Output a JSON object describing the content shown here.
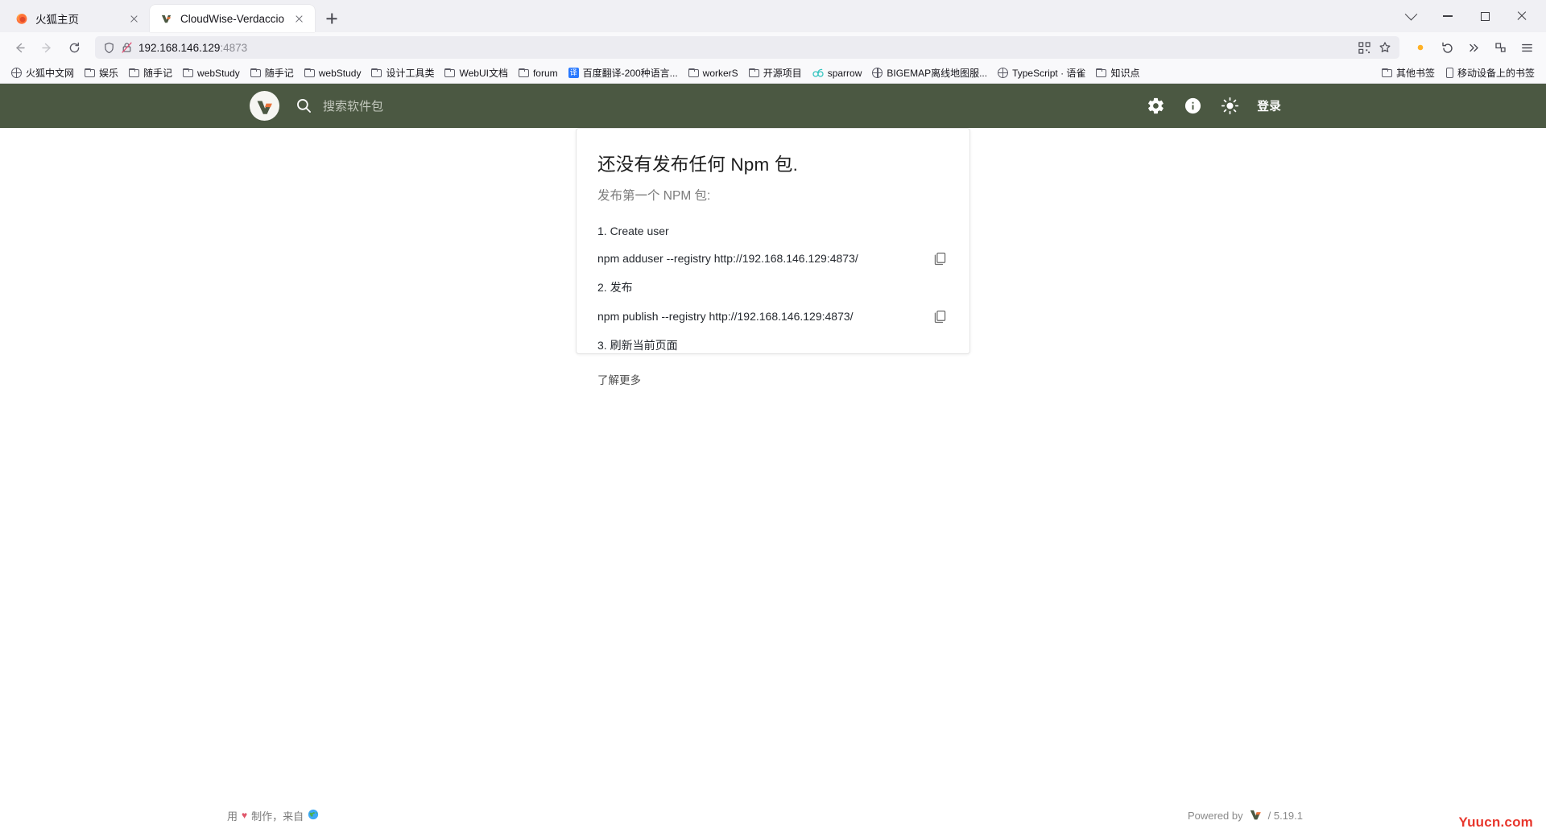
{
  "browser": {
    "tabs": [
      {
        "title": "火狐主页",
        "favicon": "firefox-icon",
        "active": false
      },
      {
        "title": "CloudWise-Verdaccio",
        "favicon": "verdaccio-icon",
        "active": true
      }
    ],
    "newtab_label": "+",
    "nav": {
      "back_icon": "back-arrow-icon",
      "forward_icon": "forward-arrow-icon",
      "reload_icon": "reload-icon",
      "shield_icon": "shield-icon",
      "lock_broken_icon": "lock-crossed-icon",
      "url_host": "192.168.146.129",
      "url_port": ":4873",
      "qr_icon": "qr-code-icon",
      "bookmark_star_icon": "star-icon",
      "account_icon": "account-dot-icon",
      "history_icon": "back-history-icon",
      "overflow_icon": "double-chevron-icon",
      "extensions_icon": "extensions-icon",
      "menu_icon": "hamburger-menu-icon"
    },
    "window_controls": {
      "list_all_tabs": "chevron-down-icon",
      "minimize": "minimize-icon",
      "maximize": "maximize-icon",
      "close": "close-icon"
    },
    "bookmarks": [
      {
        "label": "火狐中文网",
        "icon": "globe-icon"
      },
      {
        "label": "娱乐",
        "icon": "folder-icon"
      },
      {
        "label": "随手记",
        "icon": "folder-icon"
      },
      {
        "label": "webStudy",
        "icon": "folder-icon"
      },
      {
        "label": "随手记",
        "icon": "folder-icon"
      },
      {
        "label": "webStudy",
        "icon": "folder-icon"
      },
      {
        "label": "设计工具类",
        "icon": "folder-icon"
      },
      {
        "label": "WebUI文档",
        "icon": "folder-icon"
      },
      {
        "label": "forum",
        "icon": "folder-icon"
      },
      {
        "label": "百度翻译-200种语言...",
        "icon": "fanyi-icon"
      },
      {
        "label": "workerS",
        "icon": "folder-icon"
      },
      {
        "label": "开源项目",
        "icon": "folder-icon"
      },
      {
        "label": "sparrow",
        "icon": "sparrow-icon"
      },
      {
        "label": "BIGEMAP离线地图服...",
        "icon": "globe-icon"
      },
      {
        "label": "TypeScript · 语雀",
        "icon": "globe-icon"
      },
      {
        "label": "知识点",
        "icon": "folder-icon"
      }
    ],
    "bookmarks_right": [
      {
        "label": "其他书签",
        "icon": "folder-icon"
      },
      {
        "label": "移动设备上的书签",
        "icon": "mobile-icon"
      }
    ]
  },
  "verdaccio": {
    "header": {
      "logo_icon": "verdaccio-logo-icon",
      "search_icon": "search-icon",
      "search_placeholder": "搜索软件包",
      "settings_icon": "gear-icon",
      "info_icon": "info-icon",
      "theme_icon": "sun-icon",
      "login_label": "登录",
      "background_color": "#4b5842"
    },
    "card": {
      "title": "还没有发布任何 Npm 包.",
      "subtitle": "发布第一个 NPM 包:",
      "steps": [
        {
          "label": "1. Create user",
          "command": "npm adduser --registry http://192.168.146.129:4873/",
          "copy_icon": "copy-icon"
        },
        {
          "label": "2. 发布",
          "command": "npm publish --registry http://192.168.146.129:4873/",
          "copy_icon": "copy-icon"
        },
        {
          "label": "3. 刷新当前页面",
          "command": null,
          "copy_icon": null
        }
      ],
      "learn_more": "了解更多"
    },
    "footer": {
      "made_prefix": "用",
      "heart": "♥",
      "made_suffix": "制作，来自",
      "earth_icon": "earth-icon",
      "powered_by": "Powered by",
      "powered_logo_icon": "verdaccio-logo-icon",
      "version": "/ 5.19.1"
    }
  },
  "watermark": "Yuucn.com"
}
